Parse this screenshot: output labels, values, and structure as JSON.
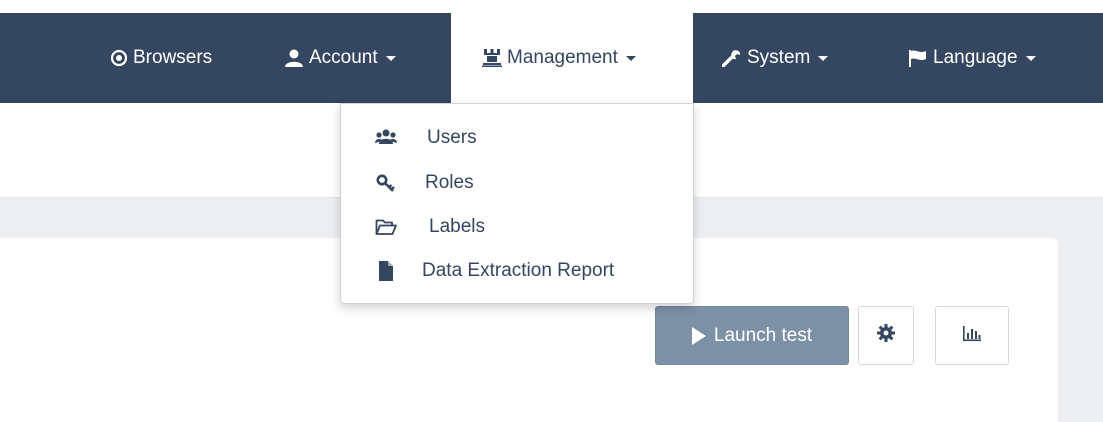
{
  "nav": {
    "browsers": "Browsers",
    "account": "Account",
    "management": "Management",
    "system": "System",
    "language": "Language"
  },
  "management_menu": {
    "items": [
      {
        "label": "Users",
        "icon": "users-icon"
      },
      {
        "label": "Roles",
        "icon": "key-icon"
      },
      {
        "label": "Labels",
        "icon": "folder-open-icon"
      },
      {
        "label": "Data Extraction Report",
        "icon": "file-icon"
      }
    ]
  },
  "toolbar": {
    "launch_label": "Launch test",
    "settings_icon": "gear-icon",
    "stats_icon": "bar-chart-icon"
  },
  "colors": {
    "navbar": "#344660",
    "launch_button": "#7d91a6",
    "content_background": "#eceef1"
  }
}
